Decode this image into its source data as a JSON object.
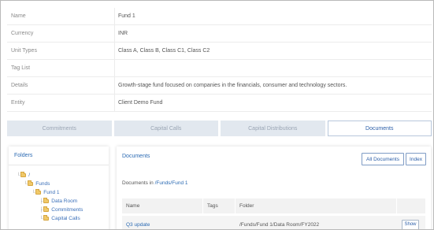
{
  "details": {
    "rows": [
      {
        "label": "Name",
        "value": "Fund 1"
      },
      {
        "label": "Currency",
        "value": "INR"
      },
      {
        "label": "Unit Types",
        "value": "Class A, Class B, Class C1, Class C2"
      },
      {
        "label": "Tag List",
        "value": ""
      },
      {
        "label": "Details",
        "value": "Growth-stage fund focused on companies in the financials, consumer and technology sectors."
      },
      {
        "label": "Entity",
        "value": "Client Demo Fund"
      }
    ]
  },
  "tabs": [
    {
      "label": "Commitments"
    },
    {
      "label": "Capital Calls"
    },
    {
      "label": "Capital Distributions"
    },
    {
      "label": "Documents"
    }
  ],
  "folders": {
    "title": "Folders",
    "tree": [
      {
        "label": "/"
      },
      {
        "label": "Funds"
      },
      {
        "label": "Fund 1"
      },
      {
        "label": "Data Room"
      },
      {
        "label": "Commitments"
      },
      {
        "label": "Capital Calls"
      }
    ]
  },
  "documents": {
    "title": "Documents",
    "all_documents_label": "All Documents",
    "index_label": "Index",
    "docs_in_prefix": "Documents in",
    "docs_in_path": "/Funds/Fund 1",
    "columns": [
      "Name",
      "Tags",
      "Folder"
    ],
    "rows": [
      {
        "name": "Q3 update",
        "tags": "",
        "folder": "/Funds/Fund 1/Data Room/FY2022",
        "action": "Show"
      }
    ]
  },
  "colors": {
    "accent": "#2b6ab3",
    "tab_inactive_bg": "#e2e8ef",
    "folder_icon": "#f0c96a"
  }
}
